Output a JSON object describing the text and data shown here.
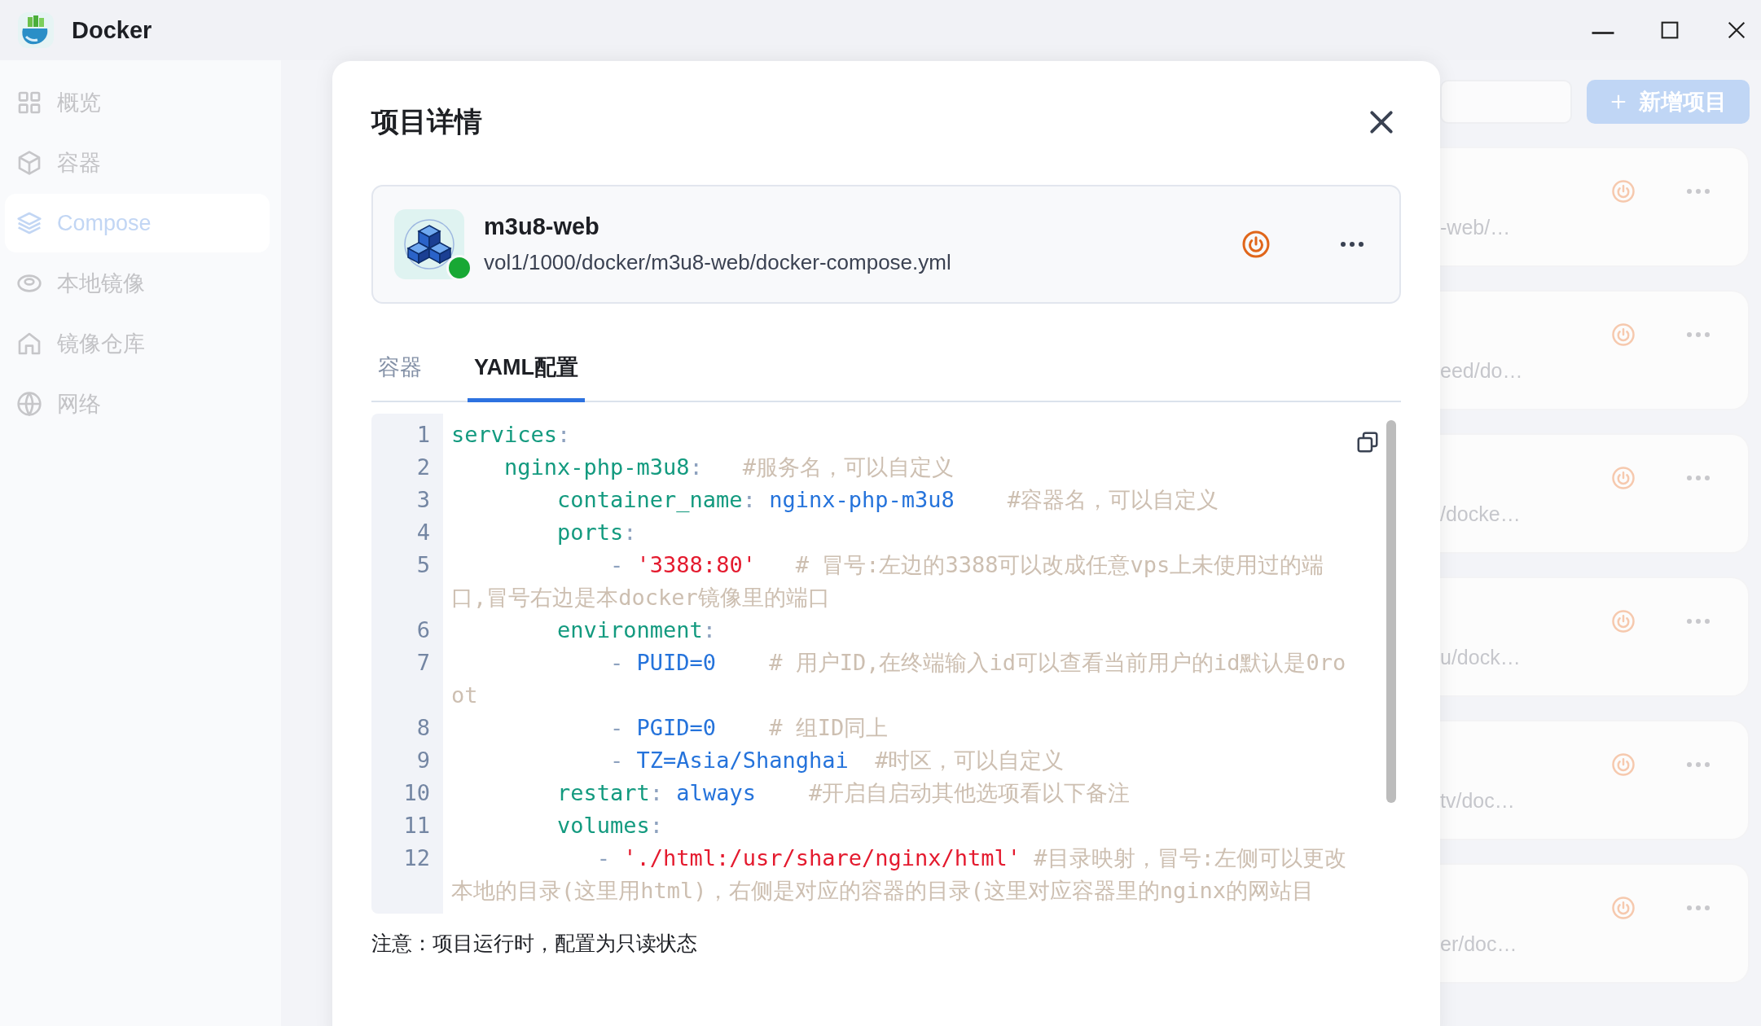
{
  "window": {
    "title": "Docker"
  },
  "sidebar": {
    "items": [
      {
        "label": "概览",
        "selected": false
      },
      {
        "label": "容器",
        "selected": false
      },
      {
        "label": "Compose",
        "selected": true
      },
      {
        "label": "本地镜像",
        "selected": false
      },
      {
        "label": "镜像仓库",
        "selected": false
      },
      {
        "label": "网络",
        "selected": false
      }
    ]
  },
  "toolbar": {
    "add_button": "新增项目"
  },
  "projects": [
    {
      "path": "-web/…"
    },
    {
      "path": "eed/do…"
    },
    {
      "path": "/docke…"
    },
    {
      "path": "u/dock…"
    },
    {
      "path": "tv/doc…"
    },
    {
      "path": "er/doc…"
    }
  ],
  "dialog": {
    "title": "项目详情",
    "project": {
      "name": "m3u8-web",
      "path": "vol1/1000/docker/m3u8-web/docker-compose.yml",
      "running": true
    },
    "tabs": [
      {
        "label": "容器",
        "selected": false
      },
      {
        "label": "YAML配置",
        "selected": true
      }
    ],
    "code_lines": [
      {
        "number": "1",
        "tokens": [
          {
            "kind": "key",
            "text": "services"
          },
          {
            "kind": "punct",
            "text": ":"
          }
        ]
      },
      {
        "number": "2",
        "tokens": [
          {
            "kind": "key",
            "text": "    nginx-php-m3u8"
          },
          {
            "kind": "punct",
            "text": ":"
          },
          {
            "kind": "comment",
            "text": "   #服务名，可以自定义"
          }
        ]
      },
      {
        "number": "3",
        "tokens": [
          {
            "kind": "key",
            "text": "        container_name"
          },
          {
            "kind": "punct",
            "text": ":"
          },
          {
            "kind": "value",
            "text": " nginx-php-m3u8"
          },
          {
            "kind": "comment",
            "text": "    #容器名，可以自定义"
          }
        ]
      },
      {
        "number": "4",
        "tokens": [
          {
            "kind": "key",
            "text": "        ports"
          },
          {
            "kind": "punct",
            "text": ":"
          }
        ]
      },
      {
        "number": "5",
        "tokens": [
          {
            "kind": "punct",
            "text": "            - "
          },
          {
            "kind": "string",
            "text": "'3388:80'"
          },
          {
            "kind": "comment",
            "text": "   # 冒号:左边的3388可以改成任意vps上未使用过的端口,冒号右边是本docker镜像里的端口"
          }
        ]
      },
      {
        "number": "6",
        "tokens": [
          {
            "kind": "key",
            "text": "        environment"
          },
          {
            "kind": "punct",
            "text": ":"
          }
        ]
      },
      {
        "number": "7",
        "tokens": [
          {
            "kind": "punct",
            "text": "            - "
          },
          {
            "kind": "value",
            "text": "PUID=0"
          },
          {
            "kind": "comment",
            "text": "    # 用户ID,在终端输入id可以查看当前用户的id默认是0root"
          }
        ]
      },
      {
        "number": "8",
        "tokens": [
          {
            "kind": "punct",
            "text": "            - "
          },
          {
            "kind": "value",
            "text": "PGID=0"
          },
          {
            "kind": "comment",
            "text": "    # 组ID同上"
          }
        ]
      },
      {
        "number": "9",
        "tokens": [
          {
            "kind": "punct",
            "text": "            - "
          },
          {
            "kind": "value",
            "text": "TZ=Asia/Shanghai"
          },
          {
            "kind": "comment",
            "text": "  #时区，可以自定义"
          }
        ]
      },
      {
        "number": "10",
        "tokens": [
          {
            "kind": "key",
            "text": "        restart"
          },
          {
            "kind": "punct",
            "text": ":"
          },
          {
            "kind": "value",
            "text": " always"
          },
          {
            "kind": "comment",
            "text": "    #开启自启动其他选项看以下备注"
          }
        ]
      },
      {
        "number": "11",
        "tokens": [
          {
            "kind": "key",
            "text": "        volumes"
          },
          {
            "kind": "punct",
            "text": ":"
          }
        ]
      },
      {
        "number": "12",
        "tokens": [
          {
            "kind": "punct",
            "text": "           - "
          },
          {
            "kind": "string",
            "text": "'./html:/usr/share/nginx/html'"
          },
          {
            "kind": "comment",
            "text": " #目录映射，冒号:左侧可以更改本地的目录(这里用html)，右侧是对应的容器的目录(这里对应容器里的nginx的网站目"
          }
        ]
      }
    ],
    "note": "注意：项目运行时，配置为只读状态"
  }
}
